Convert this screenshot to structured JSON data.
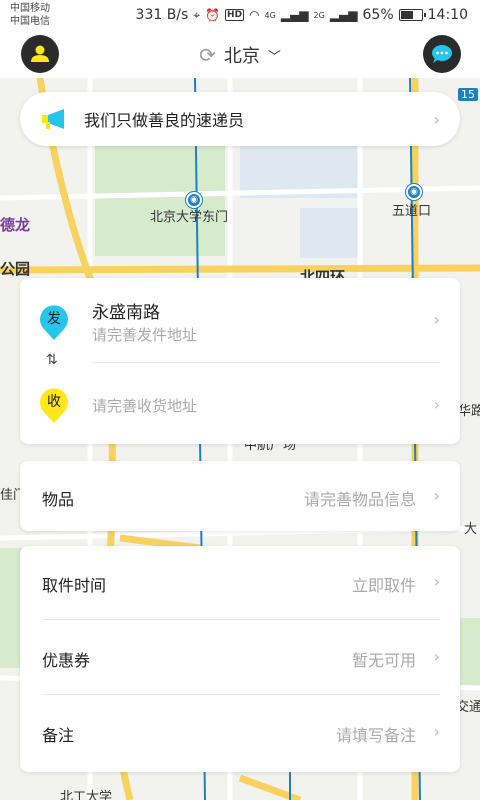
{
  "status_bar": {
    "carrier_1": "中国移动",
    "carrier_2": "中国电信",
    "net_speed": "331 B/s",
    "hd": "HD",
    "net_4g": "4G",
    "net_2g": "2G",
    "battery": "65%",
    "battery_level": 0.65,
    "time": "14:10"
  },
  "header": {
    "city": "北京",
    "user_icon": "user-icon",
    "chat_icon": "chat-bubble-icon"
  },
  "map": {
    "labels": {
      "pku_east_gate": "北京大学东门",
      "wudaokou": "五道口",
      "north_4th_ring": "北四环",
      "delong": "德龙",
      "park": "公园",
      "road_15": "15",
      "zhongguancun": "中航广场",
      "bottom_univ": "北工大学",
      "right_lu": "华路",
      "right_da": "大",
      "right_tong": "交通",
      "left_gui": "佳门"
    }
  },
  "banner": {
    "text": "我们只做善良的速递员"
  },
  "address": {
    "sender_pin": "发",
    "sender_title": "永盛南路",
    "sender_sub": "请完善发件地址",
    "receiver_pin": "收",
    "receiver_sub": "请完善收货地址"
  },
  "goods": {
    "label": "物品",
    "value": "请完善物品信息"
  },
  "options": {
    "pickup_label": "取件时间",
    "pickup_value": "立即取件",
    "coupon_label": "优惠券",
    "coupon_value": "暂无可用",
    "note_label": "备注",
    "note_value": "请填写备注"
  },
  "colors": {
    "sender_pin": "#26c6ea",
    "receiver_pin": "#ffe71a",
    "road_yellow": "#f7d25e",
    "metro_blue": "#1f7fbf"
  }
}
